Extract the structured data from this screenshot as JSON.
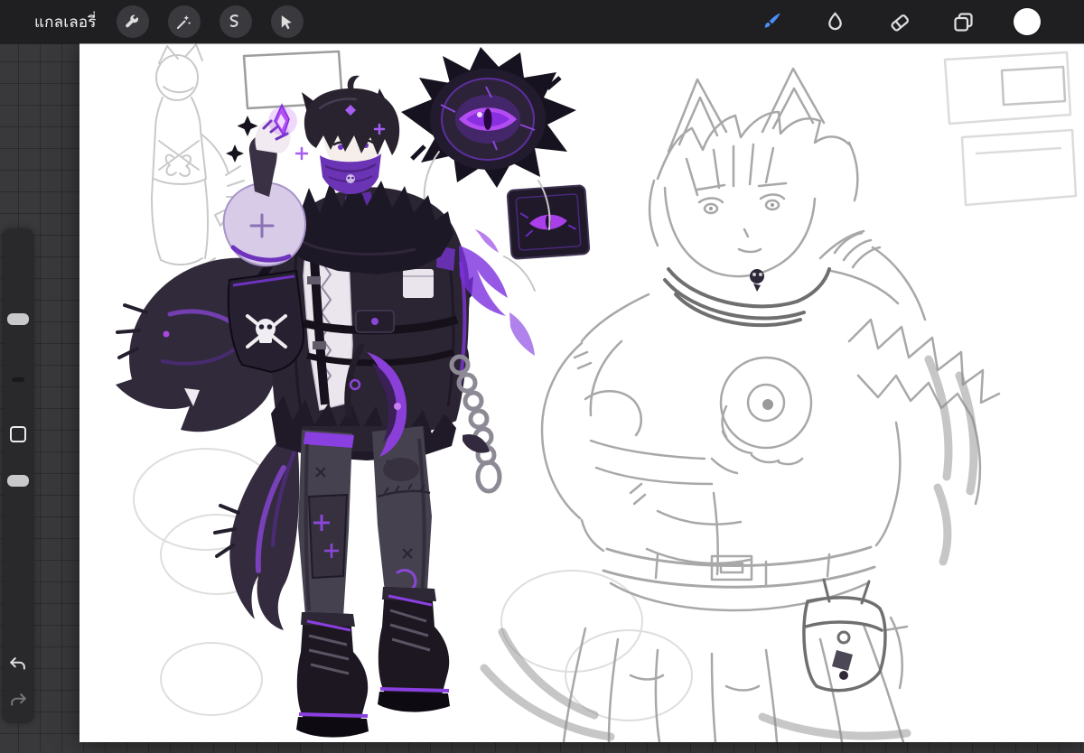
{
  "topbar": {
    "gallery_label": "แกลเลอรี่",
    "left_tools": [
      {
        "id": "actions",
        "icon": "wrench-icon"
      },
      {
        "id": "adjustments",
        "icon": "magic-wand-icon"
      },
      {
        "id": "selection",
        "icon": "selection-s-icon"
      },
      {
        "id": "transform",
        "icon": "cursor-arrow-icon"
      }
    ],
    "right_tools": [
      {
        "id": "paint",
        "icon": "paintbrush-icon",
        "active": true
      },
      {
        "id": "smudge",
        "icon": "smudge-finger-icon",
        "active": false
      },
      {
        "id": "erase",
        "icon": "eraser-icon",
        "active": false
      },
      {
        "id": "layers",
        "icon": "layers-icon",
        "active": false
      },
      {
        "id": "color",
        "icon": "color-circle",
        "active": false,
        "current_color": "#ffffff"
      }
    ]
  },
  "side_toolbar": {
    "brush_size_slider": {
      "handle": "upper"
    },
    "modify_button": {
      "shape": "square"
    },
    "opacity_slider": {
      "handle": "middle"
    },
    "undo_button": {
      "icon": "undo-arrow-icon"
    },
    "redo_button": {
      "icon": "redo-arrow-icon",
      "dimmed": true
    }
  },
  "colors": {
    "topbar_background": "#1f1f21",
    "workspace_background": "#39393b",
    "tool_button_background": "#3a3a3e",
    "active_tool_accent": "#4a8df5",
    "icon_color": "#dededf",
    "canvas_background": "#ffffff"
  },
  "canvas": {
    "artwork_description": "Anime character concept art: wolf-eared boy in a black and purple fur-trimmed jacket with skull pouch, chain and purple axe; glowing purple demon-eye emblem and matching patch; large light pencil sketch of a muscular wolf-eared figure holding an orb; assorted faint thumbnail sketches and circles",
    "artwork_palette": {
      "purple_accent": "#8a3fd9",
      "purple_bright": "#b44df2",
      "ink_dark": "#241e2b",
      "jacket_dark": "#2b2433",
      "sketch_gray": "#a8a8a8",
      "skin_tone": "#f5eeea"
    }
  }
}
